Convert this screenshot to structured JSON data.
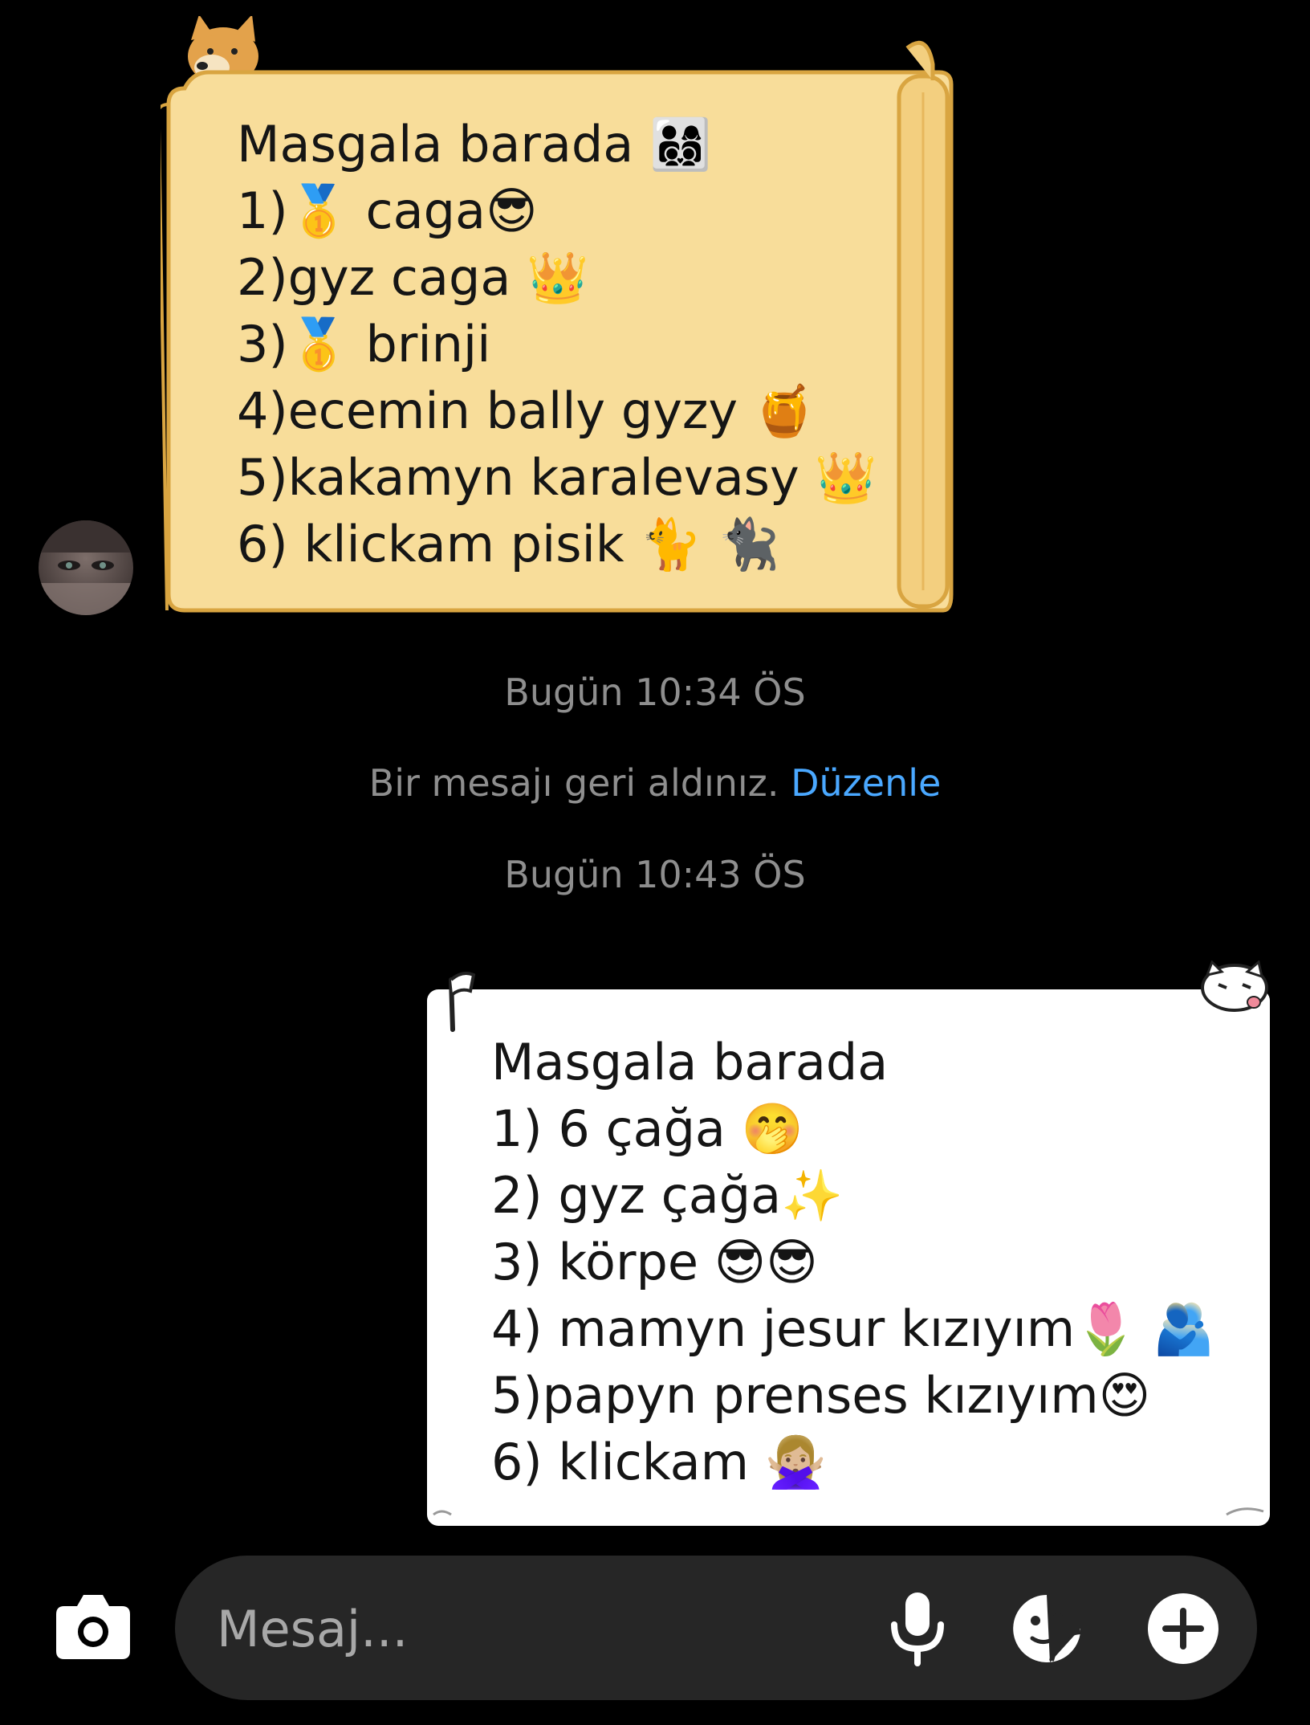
{
  "incoming_message": {
    "lines": [
      "Masgala barada 👨‍👩‍👦‍👦",
      "1)🥇 caga😎",
      "2)gyz caga 👑",
      "3)🥇 brinji",
      "4)ecemin bally gyzy 🍯",
      "5)kakamyn karalevasy 👑",
      "6) klickam pisik 🐈 🐈‍⬛"
    ]
  },
  "status": {
    "time_1": "Bugün 10:34 ÖS",
    "recall_text": "Bir mesajı geri aldınız.",
    "recall_link": "Düzenle",
    "time_2": "Bugün 10:43 ÖS"
  },
  "outgoing_message": {
    "lines": [
      "Masgala barada",
      "1) 6 çağa 🤭",
      "2) gyz çağa✨",
      "3) körpe 😎😎",
      "4) mamyn jesur kızıyım🌷 🫂",
      "5)papyn prenses kızıyım😍",
      "6) klickam 🙅🏼‍♀️"
    ]
  },
  "composer": {
    "placeholder": "Mesaj..."
  },
  "icons": {
    "camera": "camera-icon",
    "mic": "microphone-icon",
    "sticker": "sticker-icon",
    "plus": "plus-icon"
  },
  "colors": {
    "background": "#000000",
    "scroll_fill": "#f8dd9a",
    "scroll_edge": "#d9a541",
    "status_text": "#8e8e8e",
    "link": "#4aa8ff",
    "composer_bg": "#262626"
  }
}
